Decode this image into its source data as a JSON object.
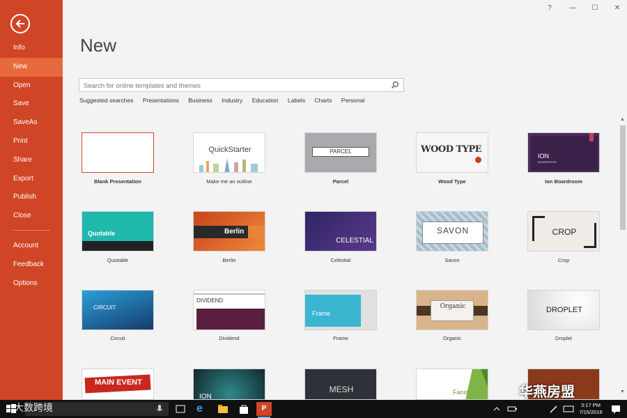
{
  "window": {
    "help": "?",
    "minimize": "—",
    "maximize": "☐",
    "close": "✕"
  },
  "sidebar": {
    "items": [
      {
        "label": "Info"
      },
      {
        "label": "New"
      },
      {
        "label": "Open"
      },
      {
        "label": "Save"
      },
      {
        "label": "SaveAs"
      },
      {
        "label": "Print"
      },
      {
        "label": "Share"
      },
      {
        "label": "Export"
      },
      {
        "label": "Publish"
      },
      {
        "label": "Close"
      }
    ],
    "bottom_items": [
      {
        "label": "Account"
      },
      {
        "label": "Feedback"
      },
      {
        "label": "Options"
      }
    ]
  },
  "main": {
    "title": "New",
    "search_placeholder": "Search for online templates and themes",
    "suggested_label": "Suggested searches",
    "suggested": [
      "Presentations",
      "Business",
      "Industry",
      "Education",
      "Labels",
      "Charts",
      "Personal"
    ]
  },
  "templates": [
    {
      "name": "Blank Presentation",
      "text": "",
      "bold": true
    },
    {
      "name": "Make me an outline",
      "text": "QuickStarter",
      "bold": false
    },
    {
      "name": "Parcel",
      "text": "PARCEL",
      "bold": true
    },
    {
      "name": "Wood Type",
      "text": "WOOD TYPE",
      "bold": true
    },
    {
      "name": "Ion Boardroom",
      "text": "ION",
      "sub": "BOARDROOM",
      "bold": true
    },
    {
      "name": "Quotable",
      "text": "Quotable",
      "bold": false
    },
    {
      "name": "Berlin",
      "text": "Berlin",
      "bold": false
    },
    {
      "name": "Celestial",
      "text": "CELESTIAL",
      "bold": false
    },
    {
      "name": "Savon",
      "text": "SAVON",
      "bold": false
    },
    {
      "name": "Crop",
      "text": "CROP",
      "bold": false
    },
    {
      "name": "Circuit",
      "text": "CIRCUIT",
      "bold": false
    },
    {
      "name": "Dividend",
      "text": "DIVIDEND",
      "bold": false
    },
    {
      "name": "Frame",
      "text": "Frame",
      "bold": false
    },
    {
      "name": "Organic",
      "text": "Organic",
      "bold": false
    },
    {
      "name": "Droplet",
      "text": "DROPLET",
      "bold": false
    },
    {
      "name": "",
      "text": "MAIN EVENT",
      "bold": false
    },
    {
      "name": "",
      "text": "ION",
      "bold": false
    },
    {
      "name": "",
      "text": "MESH",
      "bold": false
    },
    {
      "name": "",
      "text": "Facet",
      "bold": false
    },
    {
      "name": "",
      "text": "",
      "bold": false
    }
  ],
  "taskbar": {
    "time": "3:17 PM",
    "date": "7/15/2016",
    "watermark": "大数跨境",
    "brand": "华燕房盟"
  }
}
